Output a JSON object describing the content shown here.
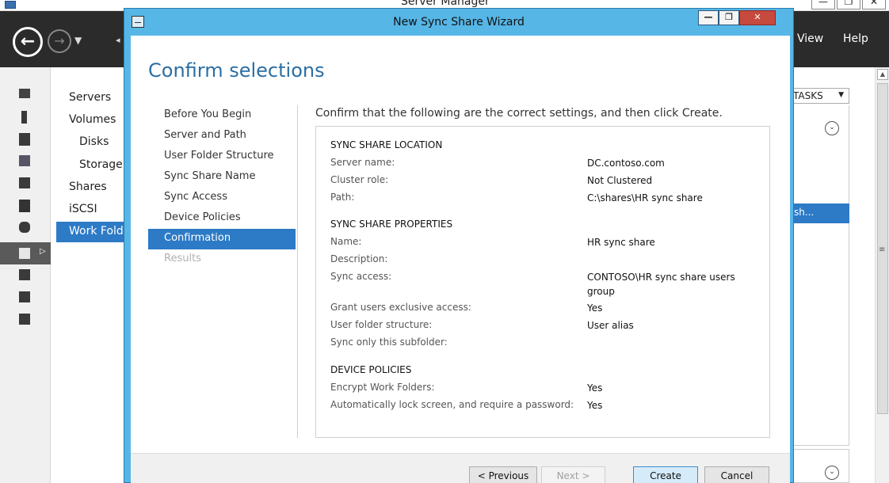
{
  "server_manager": {
    "title": "Server Manager",
    "window_controls": [
      "—",
      "❐",
      "✕"
    ],
    "menu": {
      "view": "View",
      "help": "Help"
    },
    "nav_items": [
      {
        "label": "Servers",
        "sub": false
      },
      {
        "label": "Volumes",
        "sub": false
      },
      {
        "label": "Disks",
        "sub": true
      },
      {
        "label": "Storage",
        "sub": true
      },
      {
        "label": "Shares",
        "sub": false
      },
      {
        "label": "iSCSI",
        "sub": false
      },
      {
        "label": "Work Fold",
        "sub": false,
        "active": true
      }
    ],
    "tasks_label": "TASKS",
    "selected_row_text": "sh..."
  },
  "wizard": {
    "title": "New Sync Share Wizard",
    "window_controls": {
      "minimize": "—",
      "maximize": "❐",
      "close": "✕"
    },
    "heading": "Confirm selections",
    "steps": [
      {
        "label": "Before You Begin",
        "state": "normal"
      },
      {
        "label": "Server and Path",
        "state": "normal"
      },
      {
        "label": "User Folder Structure",
        "state": "normal"
      },
      {
        "label": "Sync Share Name",
        "state": "normal"
      },
      {
        "label": "Sync Access",
        "state": "normal"
      },
      {
        "label": "Device Policies",
        "state": "normal"
      },
      {
        "label": "Confirmation",
        "state": "current"
      },
      {
        "label": "Results",
        "state": "disabled"
      }
    ],
    "intro": "Confirm that the following are the correct settings, and then click Create.",
    "summary": {
      "location": {
        "header": "SYNC SHARE LOCATION",
        "server_name_label": "Server name:",
        "server_name_value": "DC.contoso.com",
        "cluster_role_label": "Cluster role:",
        "cluster_role_value": "Not Clustered",
        "path_label": "Path:",
        "path_value": "C:\\shares\\HR sync share"
      },
      "properties": {
        "header": "SYNC SHARE PROPERTIES",
        "name_label": "Name:",
        "name_value": "HR sync share",
        "description_label": "Description:",
        "description_value": "",
        "sync_access_label": "Sync access:",
        "sync_access_value": "CONTOSO\\HR sync share users group",
        "exclusive_label": "Grant users exclusive access:",
        "exclusive_value": "Yes",
        "folder_structure_label": "User folder structure:",
        "folder_structure_value": "User alias",
        "subfolder_label": "Sync only this subfolder:",
        "subfolder_value": ""
      },
      "policies": {
        "header": "DEVICE POLICIES",
        "encrypt_label": "Encrypt Work Folders:",
        "encrypt_value": "Yes",
        "lock_label": "Automatically lock screen, and require a password:",
        "lock_value": "Yes"
      }
    },
    "buttons": {
      "previous": "< Previous",
      "next": "Next >",
      "create": "Create",
      "cancel": "Cancel"
    }
  }
}
